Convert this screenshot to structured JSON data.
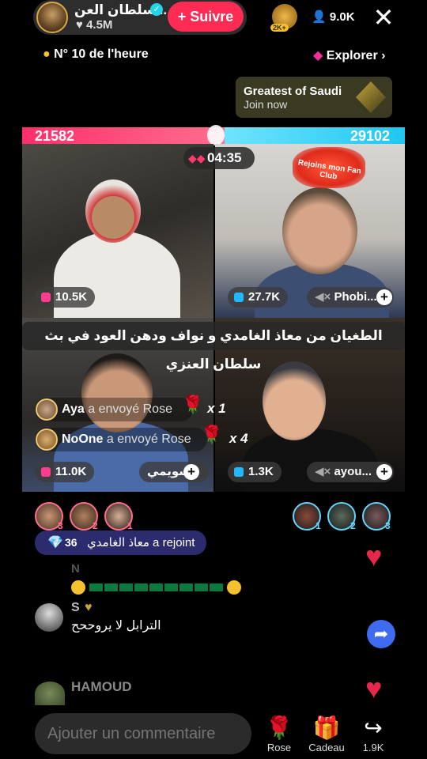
{
  "header": {
    "host_name": "سلطان العن...",
    "host_likes": "4.5M",
    "follow_label": "+ Suivre",
    "rank_badge": "2K+",
    "viewer_count": "9.0K",
    "close_label": "✕"
  },
  "subheader": {
    "hour_rank": "N° 10 de l'heure",
    "explore_label": "Explorer"
  },
  "promo": {
    "title": "Greatest of Saudi",
    "subtitle": "Join now"
  },
  "battle": {
    "left_score": "21582",
    "right_score": "29102",
    "timer": "04:35",
    "fan_club_text": "Rejoins mon Fan Club",
    "banner_text": "الطغيان من معاذ الغامدي و نواف ودهن العود في بث سلطان العنزي",
    "colors": {
      "left": "#ff2e6a",
      "right": "#1fc7f0"
    }
  },
  "tiles": [
    {
      "score": "10.5K",
      "team": "pink"
    },
    {
      "score": "27.7K",
      "team": "blue",
      "name": "Phobi..."
    },
    {
      "score": "11.0K",
      "team": "pink",
      "name": "سويمي"
    },
    {
      "score": "1.3K",
      "team": "blue",
      "name": "ayou..."
    }
  ],
  "gifts": [
    {
      "user": "Aya",
      "action": "a envoyé",
      "gift": "Rose",
      "count": "x 1"
    },
    {
      "user": "NoOne",
      "action": "a envoyé",
      "gift": "Rose",
      "count": "x 4"
    }
  ],
  "teams": {
    "left_ranks": [
      "3",
      "2",
      "1"
    ],
    "right_ranks": [
      "1",
      "2",
      "3"
    ]
  },
  "join_notice": {
    "level": "36",
    "text": "معاذ الغامدي a rejoint"
  },
  "chat": [
    {
      "user": "N",
      "message": ""
    },
    {
      "user": "S",
      "message": "الترابل لا يروححح"
    },
    {
      "user": "HAMOUD",
      "message": ""
    }
  ],
  "footer": {
    "comment_placeholder": "Ajouter un commentaire",
    "rose_label": "Rose",
    "gift_label": "Cadeau",
    "share_label": "1.9K"
  }
}
